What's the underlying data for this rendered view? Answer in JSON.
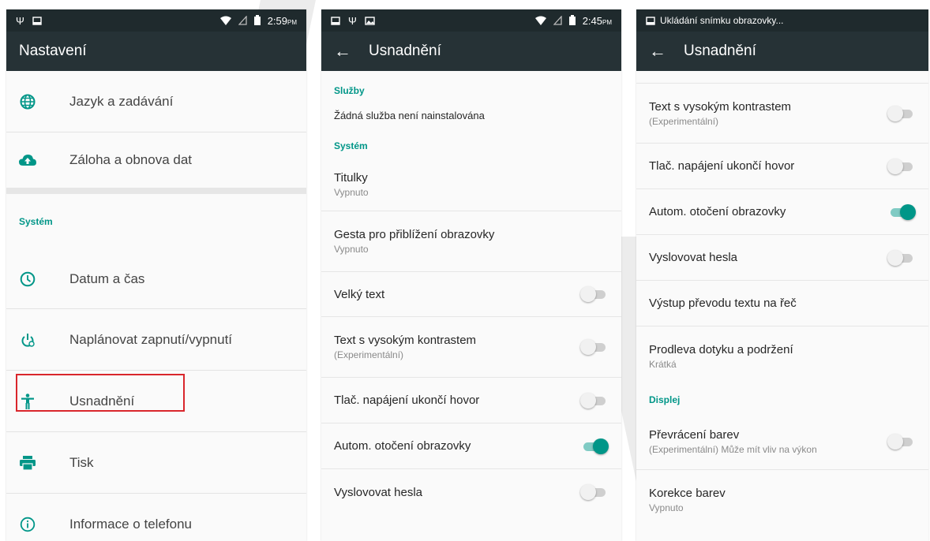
{
  "phone1": {
    "status": {
      "time": "2:59",
      "ampm": "PM"
    },
    "title": "Nastavení",
    "items_top": [
      {
        "label": "Jazyk a zadávání",
        "icon": "globe-icon"
      },
      {
        "label": "Záloha a obnova dat",
        "icon": "cloud-upload-icon"
      }
    ],
    "section_system": "Systém",
    "items_system": [
      {
        "label": "Datum a čas",
        "icon": "clock-icon"
      },
      {
        "label": "Naplánovat zapnutí/vypnutí",
        "icon": "power-schedule-icon"
      },
      {
        "label": "Usnadnění",
        "icon": "accessibility-icon"
      },
      {
        "label": "Tisk",
        "icon": "printer-icon"
      },
      {
        "label": "Informace o telefonu",
        "icon": "info-icon"
      }
    ],
    "highlight_color": "#d9262c"
  },
  "phone2": {
    "status": {
      "time": "2:45",
      "ampm": "PM"
    },
    "title": "Usnadnění",
    "section_services": "Služby",
    "no_service": "Žádná služba není nainstalována",
    "section_system": "Systém",
    "prefs": [
      {
        "title": "Titulky",
        "summary": "Vypnuto"
      },
      {
        "title": "Gesta pro přiblížení obrazovky",
        "summary": "Vypnuto"
      },
      {
        "title": "Velký text",
        "toggle": false
      },
      {
        "title": "Text s vysokým kontrastem",
        "summary": "(Experimentální)",
        "toggle": false
      },
      {
        "title": "Tlač. napájení ukončí hovor",
        "toggle": false
      },
      {
        "title": "Autom. otočení obrazovky",
        "toggle": true
      },
      {
        "title": "Vyslovovat hesla",
        "toggle": false
      }
    ]
  },
  "phone3": {
    "status": {
      "notification": "Ukládání snímku obrazovky..."
    },
    "title": "Usnadnění",
    "prefs": [
      {
        "title": "Text s vysokým kontrastem",
        "summary": "(Experimentální)",
        "toggle": false
      },
      {
        "title": "Tlač. napájení ukončí hovor",
        "toggle": false
      },
      {
        "title": "Autom. otočení obrazovky",
        "toggle": true
      },
      {
        "title": "Vyslovovat hesla",
        "toggle": false
      },
      {
        "title": "Výstup převodu textu na řeč"
      },
      {
        "title": "Prodleva dotyku a podržení",
        "summary": "Krátká"
      }
    ],
    "section_display": "Displej",
    "prefs_display": [
      {
        "title": "Převrácení barev",
        "summary": "(Experimentální) Může mít vliv na výkon",
        "toggle": false
      },
      {
        "title": "Korekce barev",
        "summary": "Vypnuto"
      }
    ]
  },
  "colors": {
    "accent": "#009688",
    "appbar": "#263236",
    "statusbar": "#1f2a2d"
  }
}
